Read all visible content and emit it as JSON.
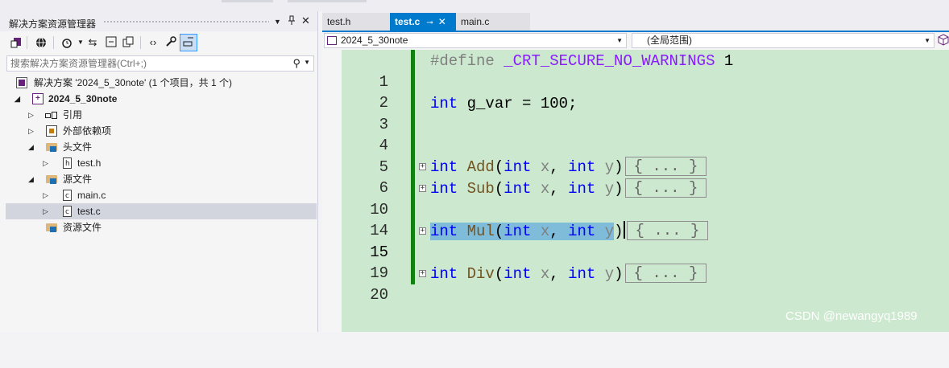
{
  "solution_explorer": {
    "title": "解决方案资源管理器",
    "controls": [
      "▾",
      "📌",
      "✕"
    ],
    "search": {
      "placeholder": "搜索解决方案资源管理器(Ctrl+;)",
      "value": ""
    },
    "tree": {
      "solution": "解决方案 '2024_5_30note' (1 个项目，共 1 个)",
      "project": "2024_5_30note",
      "references": "引用",
      "external_deps": "外部依赖项",
      "header_files": "头文件",
      "test_h": "test.h",
      "source_files": "源文件",
      "main_c": "main.c",
      "test_c": "test.c",
      "resource_files": "资源文件"
    }
  },
  "tabs": [
    {
      "label": "test.h",
      "active": false
    },
    {
      "label": "test.c",
      "active": true
    },
    {
      "label": "main.c",
      "active": false
    }
  ],
  "navbar": {
    "project_combo": "2024_5_30note",
    "scope_combo": "(全局范围)"
  },
  "code": {
    "collapsed_marker": "{ ... }",
    "lines": [
      {
        "num": "1",
        "text": "#define _CRT_SECURE_NO_WARNINGS 1"
      },
      {
        "num": "2",
        "text": ""
      },
      {
        "num": "3",
        "text": "int g_var = 100;"
      },
      {
        "num": "4",
        "text": ""
      },
      {
        "num": "5",
        "text": ""
      },
      {
        "num": "6",
        "text": "int Add(int x, int y)"
      },
      {
        "num": "10",
        "text": "int Sub(int x, int y)"
      },
      {
        "num": "14",
        "text": ""
      },
      {
        "num": "15",
        "text": "int Mul(int x, int y)"
      },
      {
        "num": "19",
        "text": ""
      },
      {
        "num": "20",
        "text": "int Div(int x, int y)"
      }
    ],
    "tokens": {
      "define": "#define",
      "macro": "_CRT_SECURE_NO_WARNINGS",
      "one": "1",
      "int": "int",
      "gvar": "g_var = 100;",
      "add": "Add",
      "sub": "Sub",
      "mul": "Mul",
      "div": "Div",
      "x": "x",
      "y": "y",
      "lp": "(",
      "comma": ",",
      "rp": ")"
    }
  },
  "watermark": "CSDN @newangyq1989",
  "colors": {
    "editor_bg": "#cce8cf",
    "keyword": "#0000ff",
    "function": "#74531f",
    "macro": "#8a1bff",
    "active_tab": "#007acc",
    "change_bar": "#108010",
    "selection": "#7fbcd9"
  }
}
